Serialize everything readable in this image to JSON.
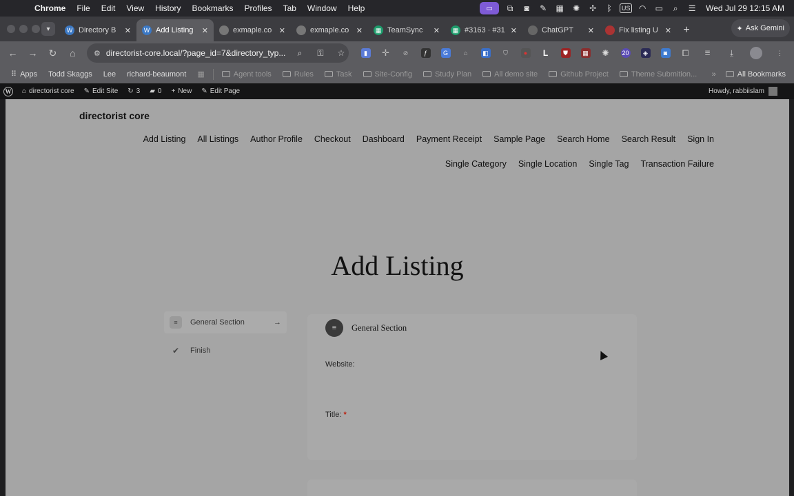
{
  "menubar": {
    "app": "Chrome",
    "items": [
      "File",
      "Edit",
      "View",
      "History",
      "Bookmarks",
      "Profiles",
      "Tab",
      "Window",
      "Help"
    ],
    "input_source": "US",
    "clock": "Wed Jul 29  12:15 AM"
  },
  "tabs": [
    {
      "label": "Directory B",
      "favicon": "wordpress-icon",
      "color": "#3b78c4"
    },
    {
      "label": "Add Listing",
      "favicon": "wordpress-icon",
      "color": "#3b78c4",
      "active": true
    },
    {
      "label": "exmaple.co",
      "favicon": "globe-icon",
      "color": "#777"
    },
    {
      "label": "exmaple.co",
      "favicon": "globe-icon",
      "color": "#777"
    },
    {
      "label": "TeamSync",
      "favicon": "teamsync-icon",
      "color": "#1e9c6c"
    },
    {
      "label": "#3163 · #31",
      "favicon": "sheet-icon",
      "color": "#1e9c6c"
    },
    {
      "label": "ChatGPT",
      "favicon": "chatgpt-icon",
      "color": "#666"
    },
    {
      "label": "Fix listing U",
      "favicon": "github-icon",
      "color": "#a33"
    }
  ],
  "gemini": {
    "label": "Ask Gemini"
  },
  "omnibox": {
    "url": "directorist-core.local/?page_id=7&directory_typ..."
  },
  "bookmarks": {
    "apps": "Apps",
    "people": [
      "Todd Skaggs",
      "Lee",
      "richard-beaumont"
    ],
    "folders": [
      "Agent tools",
      "Rules",
      "Task",
      "Site-Config",
      "Study Plan",
      "All demo site",
      "Github Project",
      "Theme Submition..."
    ],
    "all": "All Bookmarks"
  },
  "wpbar": {
    "site": "directorist core",
    "edit_site": "Edit Site",
    "updates": "3",
    "comments": "0",
    "new": "New",
    "edit_page": "Edit Page",
    "howdy": "Howdy, rabbiislam"
  },
  "site": {
    "title": "directorist core",
    "nav_row1": [
      "Add Listing",
      "All Listings",
      "Author Profile",
      "Checkout",
      "Dashboard",
      "Payment Receipt",
      "Sample Page",
      "Search Home",
      "Search Result",
      "Sign In"
    ],
    "nav_row2": [
      "Single Category",
      "Single Location",
      "Single Tag",
      "Transaction Failure"
    ]
  },
  "page": {
    "heading": "Add Listing",
    "steps": [
      {
        "label": "General Section",
        "active": true
      },
      {
        "label": "Finish",
        "active": false
      }
    ],
    "section_title": "General Section",
    "fields": [
      {
        "label": "Website:",
        "required": false
      },
      {
        "label": "Title:",
        "required": true
      }
    ],
    "required_mark": "*"
  }
}
